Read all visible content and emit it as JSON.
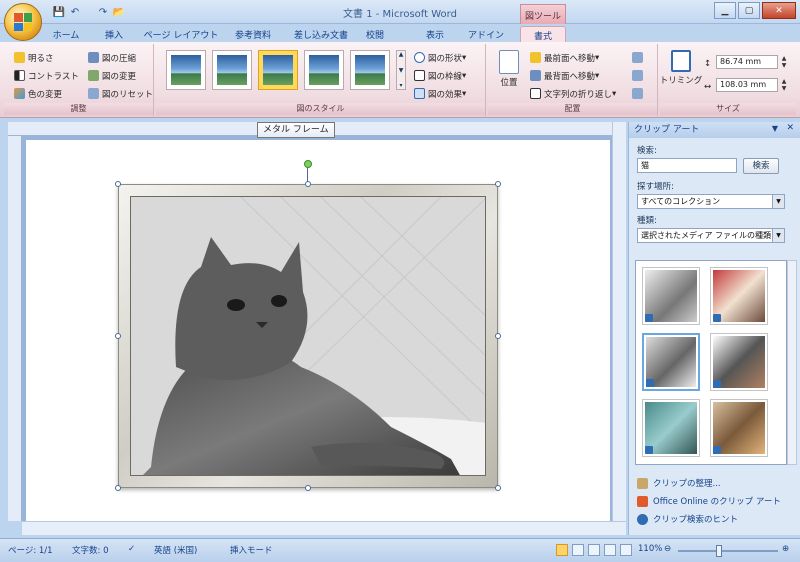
{
  "window": {
    "title": "文書 1 - Microsoft Word",
    "contextual_tab_group": "図ツール",
    "quick_access": [
      "save-icon",
      "undo-icon",
      "redo-icon",
      "folder-icon"
    ]
  },
  "tabs": [
    {
      "label": "ホーム"
    },
    {
      "label": "挿入"
    },
    {
      "label": "ページ レイアウト"
    },
    {
      "label": "参考資料"
    },
    {
      "label": "差し込み文書"
    },
    {
      "label": "校閲"
    },
    {
      "label": "表示"
    },
    {
      "label": "アドイン"
    },
    {
      "label": "書式"
    }
  ],
  "ribbon": {
    "adjust": {
      "label": "調整",
      "brightness": "明るさ",
      "contrast": "コントラスト",
      "recolor": "色の変更",
      "compress": "図の圧縮",
      "change": "図の変更",
      "reset": "図のリセット"
    },
    "styles": {
      "label": "図のスタイル",
      "shape": "図の形状",
      "border": "図の枠線",
      "effects": "図の効果"
    },
    "arrange": {
      "label": "配置",
      "position": "位置",
      "bring_front": "最前面へ移動",
      "send_back": "最背面へ移動",
      "text_wrap": "文字列の折り返し"
    },
    "size": {
      "label": "サイズ",
      "crop": "トリミング",
      "height": "86.74 mm",
      "width": "108.03 mm"
    }
  },
  "tooltip": "メタル フレーム",
  "pane": {
    "title": "クリップ アート",
    "search_label": "検索:",
    "search_value": "猫",
    "search_button": "検索",
    "location_label": "探す場所:",
    "location_value": "すべてのコレクション",
    "type_label": "種類:",
    "type_value": "選択されたメディア ファイルの種類",
    "links": [
      {
        "label": "クリップの整理..."
      },
      {
        "label": "Office Online のクリップ アート"
      },
      {
        "label": "クリップ検索のヒント"
      }
    ]
  },
  "status": {
    "page": "ページ: 1/1",
    "words": "文字数: 0",
    "language": "英語 (米国)",
    "mode": "挿入モード",
    "zoom": "110%"
  }
}
